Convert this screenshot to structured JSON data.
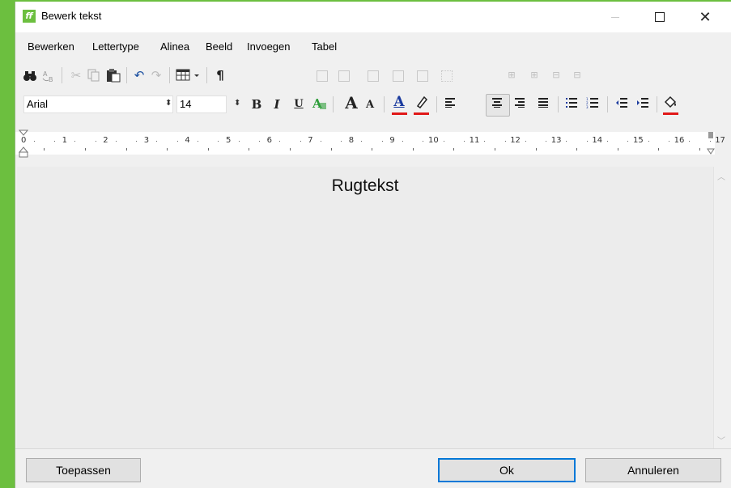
{
  "window": {
    "title": "Bewerk tekst",
    "app_icon_text": "ff",
    "minimize_glyph": "—",
    "maximize_glyph": "☐",
    "close_glyph": "✕"
  },
  "menu": {
    "items": [
      "Bewerken",
      "Lettertype",
      "Alinea",
      "Beeld",
      "Invoegen",
      "Tabel"
    ]
  },
  "toolbar": {
    "font_name": "Arial",
    "font_size": "14",
    "bold_label": "B",
    "italic_label": "I",
    "underline_label": "U",
    "grow_font_label": "A",
    "shrink_font_label": "A",
    "font_color_label": "A",
    "pilcrow": "¶",
    "icons": {
      "find": "binoculars-icon",
      "replace": "replace-icon",
      "cut": "scissors-icon",
      "copy": "copy-icon",
      "paste": "paste-icon",
      "undo": "undo-icon",
      "redo": "redo-icon",
      "table": "table-icon",
      "highlight": "highlighter-icon",
      "fill": "paint-bucket-icon"
    },
    "accent_red": "#e01818"
  },
  "ruler": {
    "numbers": [
      "0",
      "1",
      "2",
      "3",
      "4",
      "5",
      "6",
      "7",
      "8",
      "9",
      "10",
      "11",
      "12",
      "13",
      "14",
      "15",
      "16",
      "17"
    ]
  },
  "editor": {
    "text": "Rugtekst"
  },
  "buttons": {
    "apply": "Toepassen",
    "ok": "Ok",
    "cancel": "Annuleren"
  },
  "colors": {
    "frame_green": "#6cbf3f",
    "ok_focus": "#0078d7"
  }
}
